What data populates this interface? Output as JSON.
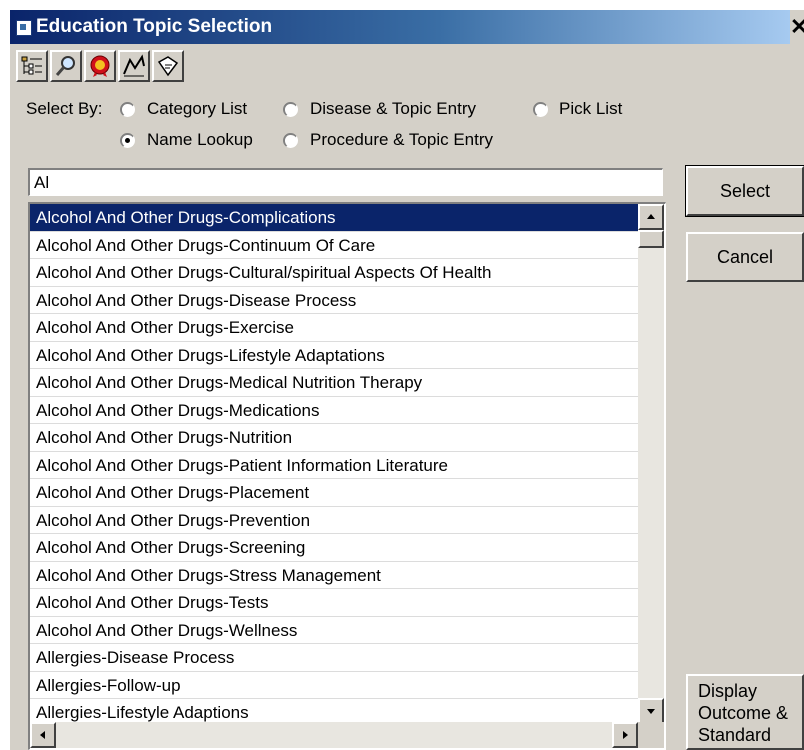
{
  "window": {
    "title": "Education Topic Selection",
    "close": "✕"
  },
  "toolbar": {
    "buttons": [
      "tree-view",
      "magnifier",
      "ribbon-badge",
      "chart-trend",
      "tag"
    ]
  },
  "select_by": {
    "label": "Select By:",
    "options": [
      {
        "label": "Category List",
        "checked": false
      },
      {
        "label": "Disease & Topic Entry",
        "checked": false
      },
      {
        "label": "Pick List",
        "checked": false
      },
      {
        "label": "Name Lookup",
        "checked": true
      },
      {
        "label": "Procedure & Topic Entry",
        "checked": false
      }
    ]
  },
  "search": {
    "value": "Al"
  },
  "list": {
    "selected_index": 0,
    "items": [
      "Alcohol And Other Drugs-Complications",
      "Alcohol And Other Drugs-Continuum Of Care",
      "Alcohol And Other Drugs-Cultural/spiritual Aspects Of Health",
      "Alcohol And Other Drugs-Disease Process",
      "Alcohol And Other Drugs-Exercise",
      "Alcohol And Other Drugs-Lifestyle Adaptations",
      "Alcohol And Other Drugs-Medical Nutrition Therapy",
      "Alcohol And Other Drugs-Medications",
      "Alcohol And Other Drugs-Nutrition",
      "Alcohol And Other Drugs-Patient Information Literature",
      "Alcohol And Other Drugs-Placement",
      "Alcohol And Other Drugs-Prevention",
      "Alcohol And Other Drugs-Screening",
      "Alcohol And Other Drugs-Stress Management",
      "Alcohol And Other Drugs-Tests",
      "Alcohol And Other Drugs-Wellness",
      "Allergies-Disease Process",
      "Allergies-Follow-up",
      "Allergies-Lifestyle Adaptions"
    ]
  },
  "buttons": {
    "select": "Select",
    "cancel": "Cancel",
    "display_line1": "Display",
    "display_line2": "Outcome &",
    "display_line3": "Standard"
  },
  "colors": {
    "selection": "#0a246a",
    "dialog": "#d4d0c8"
  }
}
